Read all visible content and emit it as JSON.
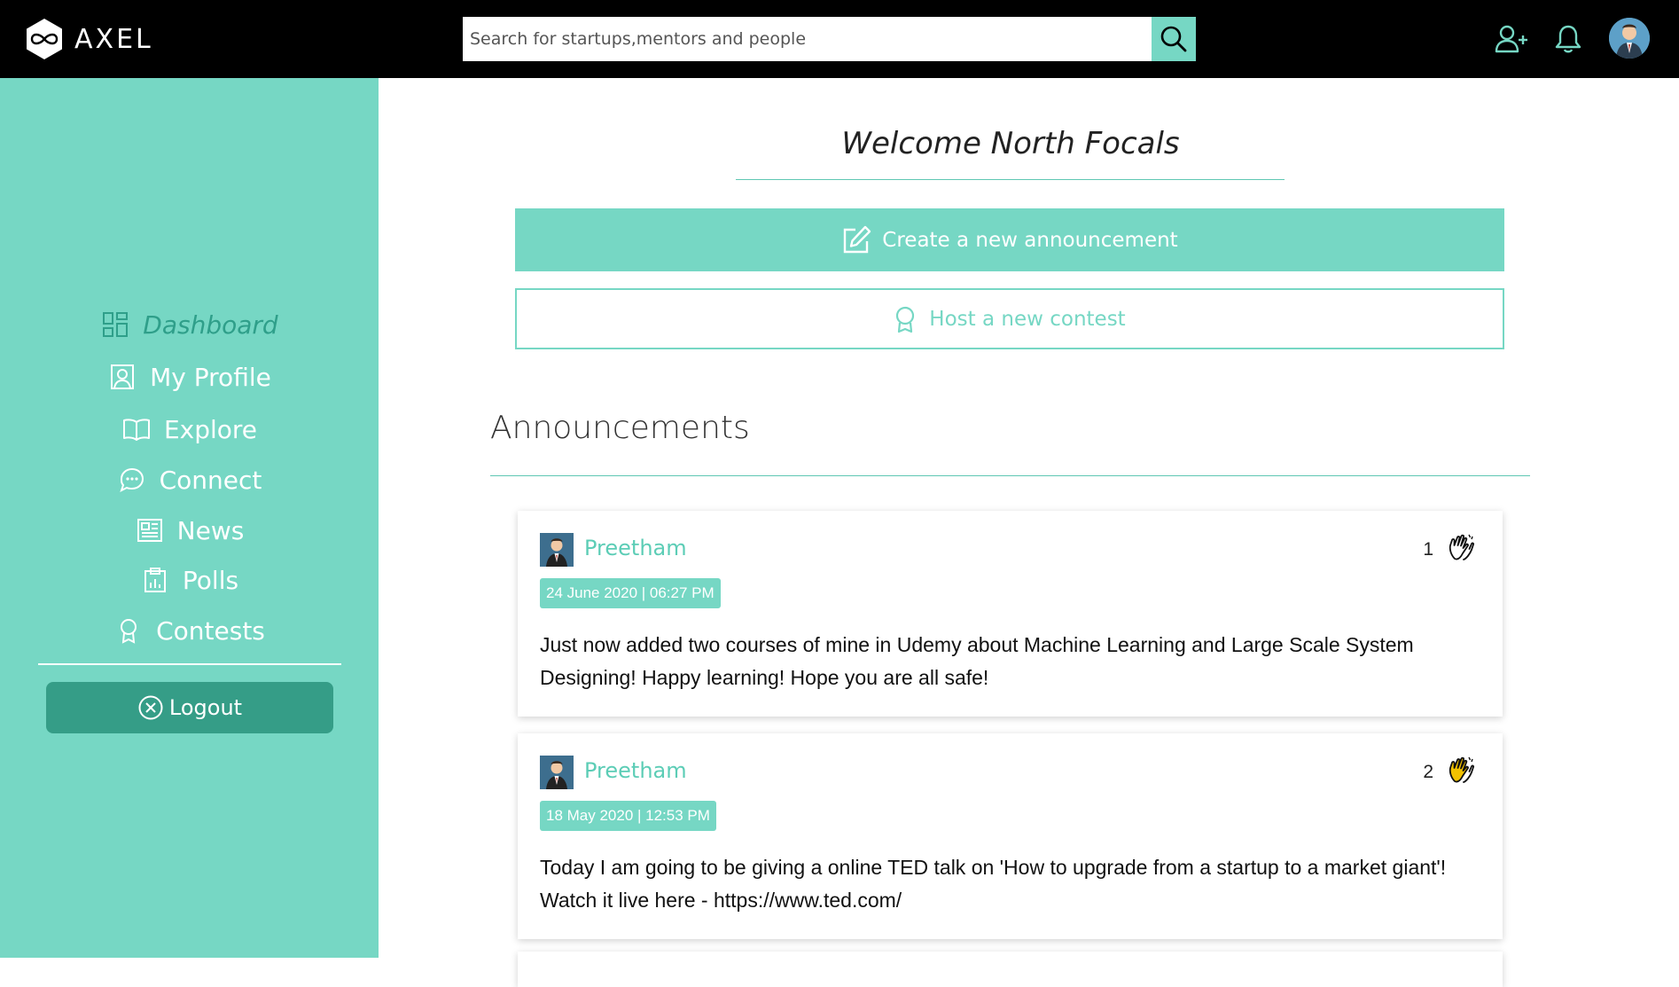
{
  "header": {
    "brand": "AXEL",
    "search_placeholder": "Search for startups,mentors and people",
    "icons": [
      "add-user-icon",
      "bell-icon"
    ]
  },
  "sidebar": {
    "items": [
      {
        "label": "Dashboard",
        "icon": "dashboard-icon",
        "active": true
      },
      {
        "label": "My Profile",
        "icon": "profile-icon"
      },
      {
        "label": "Explore",
        "icon": "book-icon"
      },
      {
        "label": "Connect",
        "icon": "chat-icon"
      },
      {
        "label": "News",
        "icon": "newspaper-icon"
      },
      {
        "label": "Polls",
        "icon": "clipboard-chart-icon"
      },
      {
        "label": "Contests",
        "icon": "award-icon"
      }
    ],
    "logout_label": "Logout"
  },
  "main": {
    "welcome": "Welcome North Focals",
    "create_label": "Create a new announcement",
    "host_label": "Host a new contest",
    "section_title": "Announcements"
  },
  "announcements": [
    {
      "author": "Preetham",
      "date": "24 June 2020 | 06:27 PM",
      "claps": "1",
      "clapped": false,
      "text": "Just now added two courses of mine in Udemy about Machine Learning and Large Scale System Designing! Happy learning! Hope you are all safe!"
    },
    {
      "author": "Preetham",
      "date": "18 May 2020 | 12:53 PM",
      "claps": "2",
      "clapped": true,
      "text": "Today I am going to be giving a online TED talk on 'How to upgrade from a startup to a market giant'! Watch it live here - https://www.ted.com/"
    }
  ],
  "colors": {
    "accent": "#76d7c4",
    "accent_dark": "#359d87",
    "active_nav": "#2f9f8a",
    "topbar": "#000000",
    "clap_active": "#f2c200"
  }
}
